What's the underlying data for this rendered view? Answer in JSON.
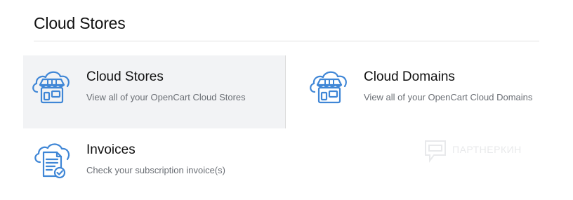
{
  "page": {
    "title": "Cloud Stores"
  },
  "cards": [
    {
      "title": "Cloud Stores",
      "description": "View all of your OpenCart Cloud Stores",
      "icon": "cloud-store-icon"
    },
    {
      "title": "Cloud Domains",
      "description": "View all of your OpenCart Cloud Domains",
      "icon": "cloud-store-icon"
    },
    {
      "title": "Invoices",
      "description": "Check your subscription invoice(s)",
      "icon": "cloud-invoice-icon"
    }
  ],
  "watermark": {
    "text": "ПАРТНЕРКИН"
  },
  "colors": {
    "icon_blue": "#3f86d6",
    "active_card_bg": "#f2f3f5",
    "description_gray": "#6b6f75"
  }
}
